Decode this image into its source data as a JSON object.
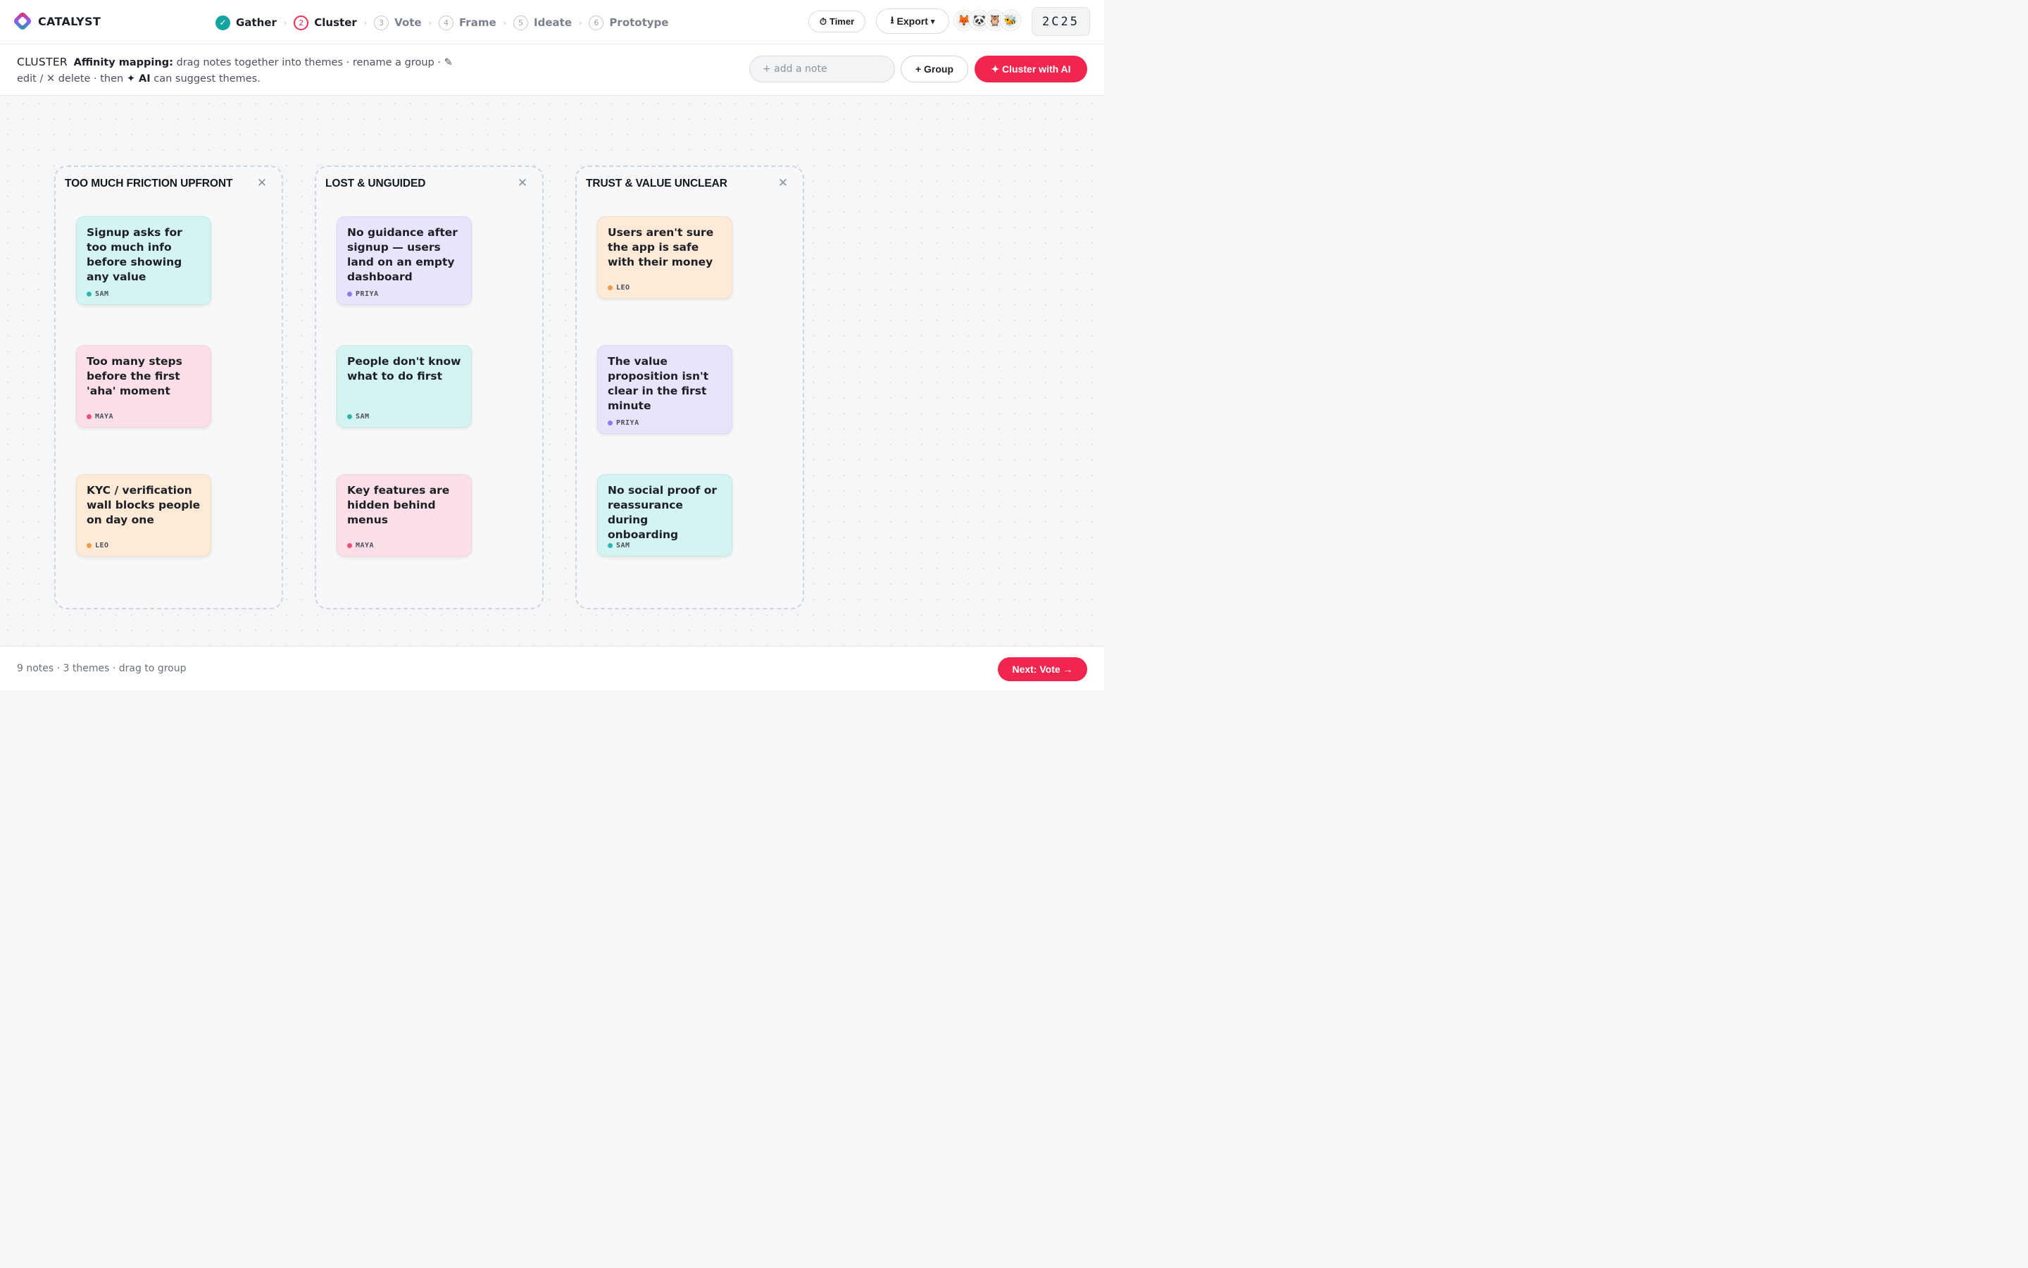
{
  "app": {
    "name": "CATALYST",
    "room_code": "2C25"
  },
  "steps": [
    {
      "num": "✓",
      "label": "Gather",
      "state": "complete"
    },
    {
      "num": "2",
      "label": "Cluster",
      "state": "current"
    },
    {
      "num": "3",
      "label": "Vote",
      "state": "upcoming"
    },
    {
      "num": "4",
      "label": "Frame",
      "state": "upcoming"
    },
    {
      "num": "5",
      "label": "Ideate",
      "state": "upcoming"
    },
    {
      "num": "6",
      "label": "Prototype",
      "state": "upcoming"
    }
  ],
  "step_separator": "›",
  "toolbar": {
    "timer_icon": "⏱",
    "timer_label": "Timer",
    "export_icon": "⭳",
    "export_label": "Export",
    "export_caret": "▾"
  },
  "participants": [
    "🦊",
    "🐼",
    "🦉",
    "🐝"
  ],
  "instructions": {
    "phase": "CLUSTER",
    "lead": "Affinity mapping:",
    "text_1": " drag notes together into themes · rename a group · ✎ edit / ✕ delete · then ",
    "ai_word": "✦ AI",
    "text_2": " can suggest themes."
  },
  "actions": {
    "note_placeholder": "+ add a note",
    "group_label": "+ Group",
    "ai_label": "✦ Cluster with AI"
  },
  "colors": {
    "accent": "#f0264f",
    "complete": "#15a3a0",
    "note_teal": "#d3f4f0",
    "note_pink": "#fde0e7",
    "note_peach": "#feead6",
    "note_lavender": "#e8e4fc",
    "author_sam": "#2fb3ad",
    "author_maya": "#ef4f78",
    "author_leo": "#f2994a",
    "author_priya": "#8b7cf0"
  },
  "groups": [
    {
      "title": "TOO MUCH FRICTION UPFRONT",
      "close": "✕",
      "notes": [
        {
          "text": "Signup asks for too much info before showing any value",
          "author": "SAM",
          "color": "teal"
        },
        {
          "text": "Too many steps before the first 'aha' moment",
          "author": "MAYA",
          "color": "pink"
        },
        {
          "text": "KYC / verification wall blocks people on day one",
          "author": "LEO",
          "color": "peach"
        }
      ]
    },
    {
      "title": "LOST & UNGUIDED",
      "close": "✕",
      "notes": [
        {
          "text": "No guidance after signup — users land on an empty dashboard",
          "author": "PRIYA",
          "color": "lavender"
        },
        {
          "text": "People don't know what to do first",
          "author": "SAM",
          "color": "teal"
        },
        {
          "text": "Key features are hidden behind menus",
          "author": "MAYA",
          "color": "pink"
        }
      ]
    },
    {
      "title": "TRUST & VALUE UNCLEAR",
      "close": "✕",
      "notes": [
        {
          "text": "Users aren't sure the app is safe with their money",
          "author": "LEO",
          "color": "peach"
        },
        {
          "text": "The value proposition isn't clear in the first minute",
          "author": "PRIYA",
          "color": "lavender"
        },
        {
          "text": "No social proof or reassurance during onboarding",
          "author": "SAM",
          "color": "teal"
        }
      ]
    }
  ],
  "footer": {
    "status": "9 notes · 3 themes · drag to group",
    "next_label": "Next: Vote →"
  }
}
